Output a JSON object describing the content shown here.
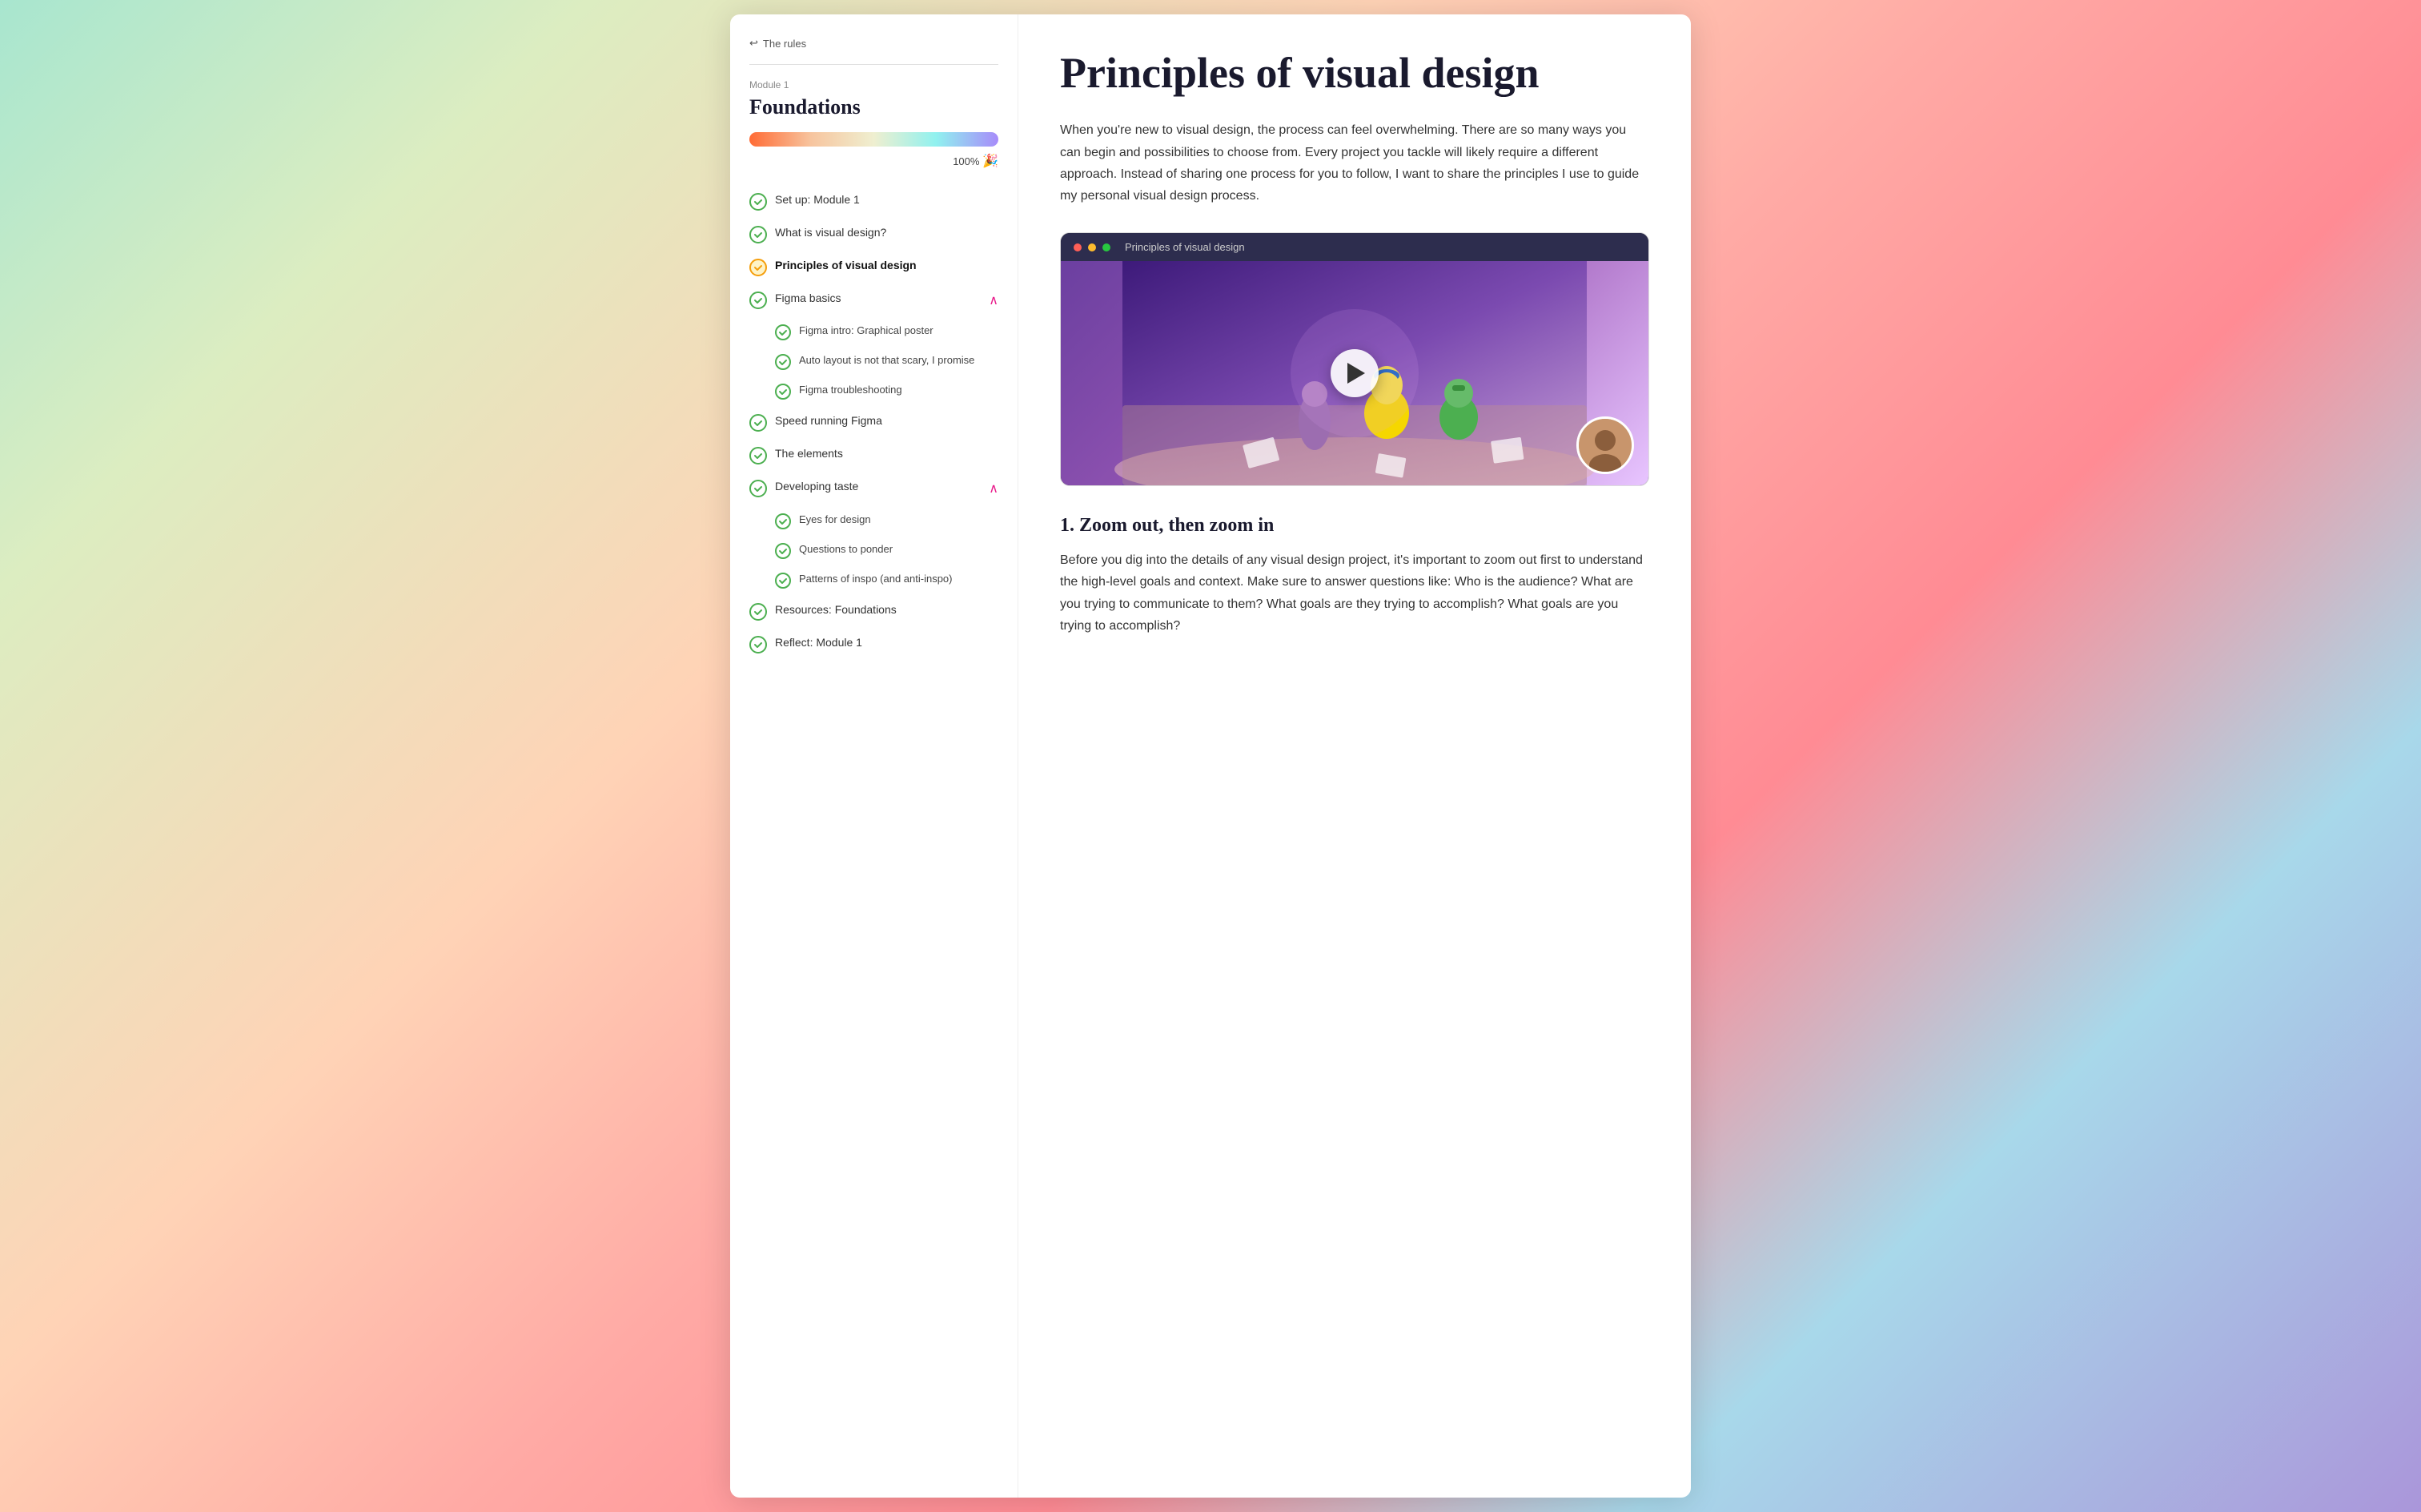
{
  "sidebar": {
    "back_label": "The rules",
    "module_label": "Module 1",
    "module_title": "Foundations",
    "progress_percent": "100%",
    "progress_emoji": "🎉",
    "nav_items": [
      {
        "label": "Set up: Module 1",
        "completed": true,
        "active": false,
        "has_subnav": false
      },
      {
        "label": "What is visual design?",
        "completed": true,
        "active": false,
        "has_subnav": false
      },
      {
        "label": "Principles of visual design",
        "completed": true,
        "active": true,
        "has_subnav": false
      },
      {
        "label": "Figma basics",
        "completed": true,
        "active": false,
        "has_subnav": true,
        "expanded": true,
        "sub_items": [
          {
            "label": "Figma intro: Graphical poster",
            "completed": true
          },
          {
            "label": "Auto layout is not that scary, I promise",
            "completed": true
          },
          {
            "label": "Figma troubleshooting",
            "completed": true
          }
        ]
      },
      {
        "label": "Speed running Figma",
        "completed": true,
        "active": false,
        "has_subnav": false
      },
      {
        "label": "The elements",
        "completed": true,
        "active": false,
        "has_subnav": false
      },
      {
        "label": "Developing taste",
        "completed": true,
        "active": false,
        "has_subnav": true,
        "expanded": true,
        "sub_items": [
          {
            "label": "Eyes for design",
            "completed": true
          },
          {
            "label": "Questions to ponder",
            "completed": true
          },
          {
            "label": "Patterns of inspo (and anti-inspo)",
            "completed": true
          }
        ]
      },
      {
        "label": "Resources: Foundations",
        "completed": true,
        "active": false,
        "has_subnav": false
      },
      {
        "label": "Reflect: Module 1",
        "completed": true,
        "active": false,
        "has_subnav": false
      }
    ]
  },
  "main": {
    "page_title": "Principles of visual design",
    "intro_text": "When you're new to visual design, the process can feel overwhelming. There are so many ways you can begin and possibilities to choose from. Every project you tackle will likely require a different approach. Instead of sharing one process for you to follow, I want to share the principles I use to guide my personal visual design process.",
    "video": {
      "title": "Principles of visual design",
      "play_label": "▶"
    },
    "section1": {
      "heading": "1. Zoom out, then zoom in",
      "text": "Before you dig into the details of any visual design project, it's important to zoom out first to understand the high-level goals and context. Make sure to answer questions like: Who is the audience? What are you trying to communicate to them? What goals are they trying to accomplish? What goals are you trying to accomplish?"
    }
  },
  "icons": {
    "back_arrow": "↩",
    "check": "✓",
    "chevron_up": "∧",
    "play": "▶"
  }
}
